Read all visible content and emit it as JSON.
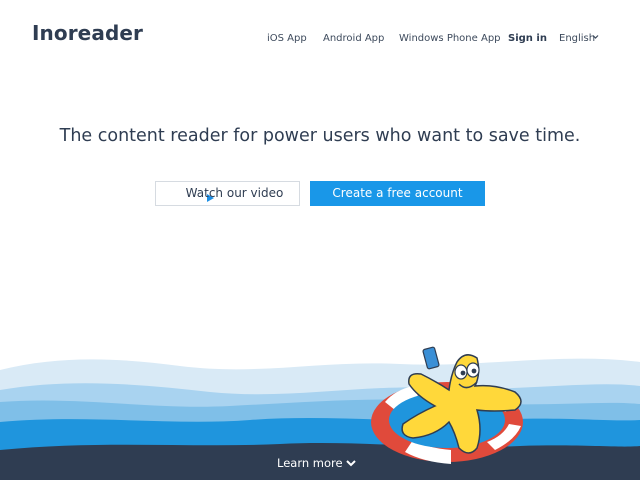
{
  "header": {
    "logo": "Inoreader",
    "nav": {
      "ios": "iOS App",
      "android": "Android App",
      "windows_phone": "Windows Phone App",
      "sign_in": "Sign in",
      "language": "English"
    }
  },
  "hero": {
    "headline": "The content reader for power users who want to save time.",
    "watch_video_label": "Watch our video",
    "create_account_label": "Create a free account"
  },
  "footer": {
    "learn_more": "Learn more"
  },
  "colors": {
    "primary": "#1997e8",
    "text_dark": "#2f3d52",
    "wave_light": "#d9eaf6",
    "wave_mid": "#7fbfe8",
    "wave_blue": "#1f95dd",
    "wave_dark": "#2f3d52",
    "mascot_yellow": "#ffd83a",
    "ring_red": "#e04a3b"
  },
  "icons": {
    "play": "play-icon",
    "chevron_language": "chevron-down-icon",
    "chevron_learn": "chevron-down-icon"
  }
}
